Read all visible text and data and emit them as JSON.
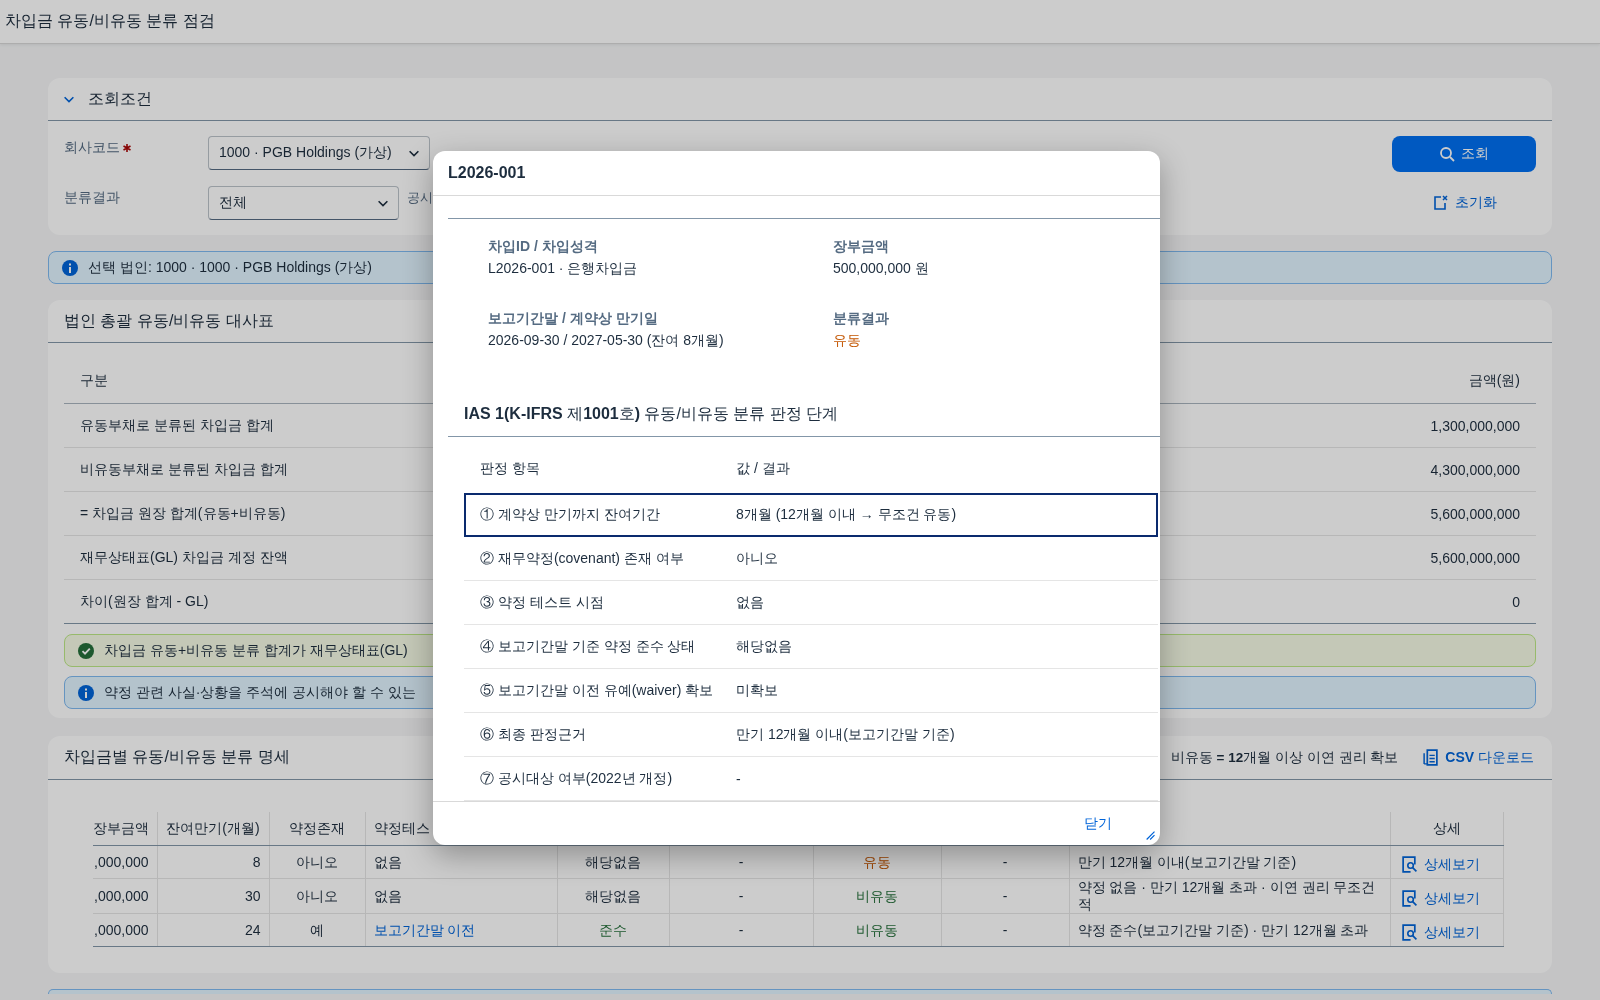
{
  "page": {
    "title": "차입금 유동/비유동 분류 점검"
  },
  "filter_panel": {
    "title": "조회조건",
    "expanded": true,
    "fields": [
      {
        "label": "회사코드",
        "required": true,
        "value": "1000 · PGB Holdings (가상)"
      },
      {
        "label": "분류결과",
        "required": false,
        "value": "전체"
      }
    ],
    "trailing_label": "공시",
    "search_button": "조회",
    "reset_button": "초기화"
  },
  "selection_strip": {
    "text": "선택 법인: 1000 · 1000 · PGB Holdings (가상)"
  },
  "reconciliation": {
    "title": "법인 총괄 유동/비유동 대사표",
    "columns": [
      "구분",
      "금액(원)"
    ],
    "rows": [
      {
        "label": "유동부채로 분류된 차입금 합계",
        "amount": "1,300,000,000"
      },
      {
        "label": "비유동부채로 분류된 차입금 합계",
        "amount": "4,300,000,000"
      },
      {
        "label": "= 차입금 원장 합계(유동+비유동)",
        "amount": "5,600,000,000"
      },
      {
        "label": "재무상태표(GL) 차입금 계정 잔액",
        "amount": "5,600,000,000"
      },
      {
        "label": "차이(원장 합계 - GL)",
        "amount": "0"
      }
    ],
    "messages": [
      {
        "kind": "success",
        "text": "차입금 유동+비유동 분류 합계가 재무상태표(GL)"
      },
      {
        "kind": "info",
        "text": "약정 관련 사실·상황을 주석에 공시해야 할 수 있는"
      }
    ]
  },
  "detail": {
    "title": "차입금별 유동/비유동 분류 명세",
    "legend": "비유동 **=** **12**개월 이상 이연 권리 확보",
    "csv_button": "**CSV** 다운로드",
    "columns": [
      "장부금액",
      "잔여만기(개월)",
      "약정존재",
      "약정테스"
    ],
    "last_column": "상세",
    "rows": [
      {
        "cells": [
          {
            "kind": "plain",
            "text": ",000,000"
          },
          {
            "kind": "plain",
            "text": "8"
          },
          {
            "kind": "plain",
            "text": "아니오"
          },
          {
            "kind": "plain",
            "text": "없음"
          },
          {
            "kind": "plain",
            "text": "해당없음"
          },
          {
            "kind": "plain",
            "text": "-"
          },
          {
            "kind": "current",
            "text": "유동"
          },
          {
            "kind": "plain",
            "text": "-"
          },
          {
            "kind": "plain",
            "text": "만기 12개월 이내(보고기간말 기준)"
          }
        ],
        "link": "상세보기"
      },
      {
        "cells": [
          {
            "kind": "plain",
            "text": ",000,000"
          },
          {
            "kind": "plain",
            "text": "30"
          },
          {
            "kind": "plain",
            "text": "아니오"
          },
          {
            "kind": "plain",
            "text": "없음"
          },
          {
            "kind": "plain",
            "text": "해당없음"
          },
          {
            "kind": "plain",
            "text": "-"
          },
          {
            "kind": "noncurrent",
            "text": "비유동"
          },
          {
            "kind": "plain",
            "text": "-"
          },
          {
            "kind": "plain",
            "text": "약정 없음 · 만기 12개월 초과 · 이연 권리 무조건적"
          }
        ],
        "link": "상세보기"
      },
      {
        "cells": [
          {
            "kind": "plain",
            "text": ",000,000"
          },
          {
            "kind": "plain",
            "text": "24"
          },
          {
            "kind": "plain",
            "text": "예"
          },
          {
            "kind": "link",
            "text": "보고기간말 이전"
          },
          {
            "kind": "compliant",
            "text": "준수"
          },
          {
            "kind": "plain",
            "text": "-"
          },
          {
            "kind": "noncurrent",
            "text": "비유동"
          },
          {
            "kind": "plain",
            "text": "-"
          },
          {
            "kind": "plain",
            "text": "약정 준수(보고기간말 기준) · 만기 12개월 초과"
          }
        ],
        "link": "상세보기"
      }
    ]
  },
  "dialog": {
    "title": "L2026-001",
    "fields": [
      {
        "label": "차입ID / 차입성격",
        "value": "L2026-001 · 은행차입금",
        "kind": "plain"
      },
      {
        "label": "장부금액",
        "value": "500,000,000 원",
        "kind": "plain"
      },
      {
        "label": "보고기간말 / 계약상 만기일",
        "value": "2026-09-30 / 2027-05-30 (잔여 8개월)",
        "kind": "plain"
      },
      {
        "label": "분류결과",
        "value": "유동",
        "kind": "current"
      }
    ],
    "section_title": "**IAS 1(K-IFRS** 제**1001**호**)** 유동/비유동 분류 판정 단계",
    "columns": [
      "판정 항목",
      "값 / 결과"
    ],
    "steps": [
      {
        "item": "① 계약상 만기까지 잔여기간",
        "result": "8개월 (12개월 이내 → 무조건 유동)",
        "selected": true
      },
      {
        "item": "② 재무약정(covenant) 존재 여부",
        "result": "아니오",
        "selected": false
      },
      {
        "item": "③ 약정 테스트 시점",
        "result": "없음",
        "selected": false
      },
      {
        "item": "④ 보고기간말 기준 약정 준수 상태",
        "result": "해당없음",
        "selected": false
      },
      {
        "item": "⑤ 보고기간말 이전 유예(waiver) 확보",
        "result": "미확보",
        "selected": false
      },
      {
        "item": "⑥ 최종 판정근거",
        "result": "만기 12개월 이내(보고기간말 기준)",
        "selected": false
      },
      {
        "item": "⑦ 공시대상 여부(2022년 개정)",
        "result": "-",
        "selected": false
      }
    ],
    "close_button": "닫기"
  }
}
